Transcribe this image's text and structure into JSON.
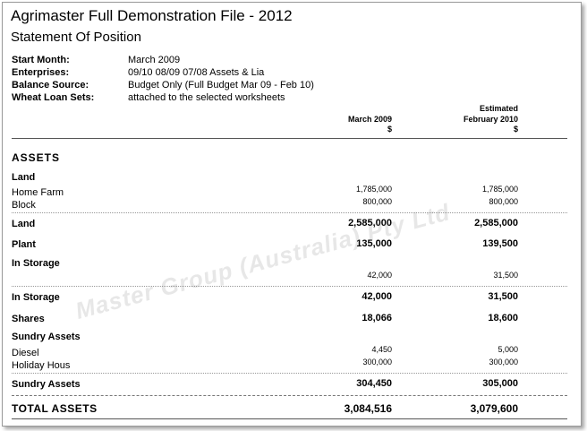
{
  "header": {
    "title": "Agrimaster Full Demonstration File - 2012",
    "subtitle": "Statement Of Position"
  },
  "meta": [
    {
      "label": "Start Month:",
      "value": "March 2009"
    },
    {
      "label": "Enterprises:",
      "value": "09/10 08/09 07/08 Assets & Lia"
    },
    {
      "label": "Balance Source:",
      "value": "Budget Only (Full Budget Mar 09 - Feb 10)"
    },
    {
      "label": "Wheat Loan Sets:",
      "value": "attached to the selected worksheets"
    }
  ],
  "columns": {
    "col1": {
      "line1": "",
      "line2": "March 2009",
      "unit": "$"
    },
    "col2": {
      "line1": "Estimated",
      "line2": "February 2010",
      "unit": "$"
    }
  },
  "section_title": "ASSETS",
  "groups": {
    "land_heading": "Land",
    "home_farm": {
      "label": "Home Farm",
      "v1": "1,785,000",
      "v2": "1,785,000"
    },
    "block": {
      "label": "Block",
      "v1": "800,000",
      "v2": "800,000"
    },
    "land_total": {
      "label": "Land",
      "v1": "2,585,000",
      "v2": "2,585,000"
    },
    "plant": {
      "label": "Plant",
      "v1": "135,000",
      "v2": "139,500"
    },
    "storage_heading": "In Storage",
    "storage_item": {
      "v1": "42,000",
      "v2": "31,500"
    },
    "storage_total": {
      "label": "In Storage",
      "v1": "42,000",
      "v2": "31,500"
    },
    "shares": {
      "label": "Shares",
      "v1": "18,066",
      "v2": "18,600"
    },
    "sundry_heading": "Sundry Assets",
    "diesel": {
      "label": "Diesel",
      "v1": "4,450",
      "v2": "5,000"
    },
    "holiday": {
      "label": "Holiday Hous",
      "v1": "300,000",
      "v2": "300,000"
    },
    "sundry_total": {
      "label": "Sundry Assets",
      "v1": "304,450",
      "v2": "305,000"
    },
    "total_assets": {
      "label": "TOTAL ASSETS",
      "v1": "3,084,516",
      "v2": "3,079,600"
    }
  },
  "watermark": "Master Group (Australia) Pty Ltd"
}
